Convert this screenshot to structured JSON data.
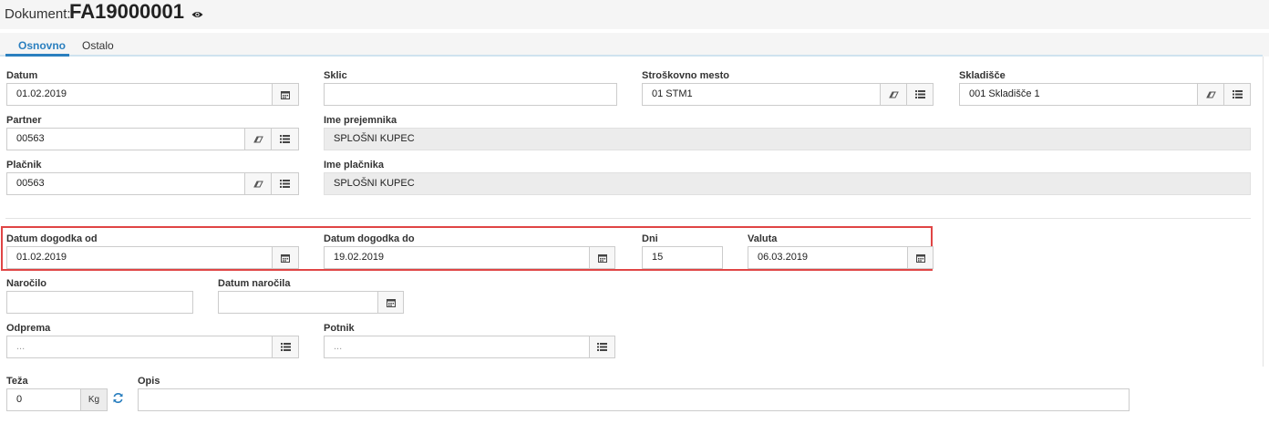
{
  "header": {
    "label": "Dokument:",
    "number": "FA19000001"
  },
  "tabs": [
    {
      "label": "Osnovno"
    },
    {
      "label": "Ostalo"
    }
  ],
  "form": {
    "datum": {
      "label": "Datum",
      "value": "01.02.2019"
    },
    "sklic": {
      "label": "Sklic",
      "value": ""
    },
    "strosek": {
      "label": "Stroškovno mesto",
      "value": "01 STM1"
    },
    "skladisce": {
      "label": "Skladišče",
      "value": "001 Skladišče 1"
    },
    "partner": {
      "label": "Partner",
      "value": "00563"
    },
    "ime_prejemnika": {
      "label": "Ime prejemnika",
      "value": "SPLOŠNI KUPEC"
    },
    "placnik": {
      "label": "Plačnik",
      "value": "00563"
    },
    "ime_placnika": {
      "label": "Ime plačnika",
      "value": "SPLOŠNI KUPEC"
    },
    "datum_od": {
      "label": "Datum dogodka od",
      "value": "01.02.2019"
    },
    "datum_do": {
      "label": "Datum dogodka do",
      "value": "19.02.2019"
    },
    "dni": {
      "label": "Dni",
      "value": "15"
    },
    "valuta": {
      "label": "Valuta",
      "value": "06.03.2019"
    },
    "narocilo": {
      "label": "Naročilo",
      "value": ""
    },
    "datum_narocila": {
      "label": "Datum naročila",
      "value": ""
    },
    "odprema": {
      "label": "Odprema",
      "placeholder": "..."
    },
    "potnik": {
      "label": "Potnik",
      "placeholder": "..."
    },
    "teza": {
      "label": "Teža",
      "value": "0",
      "unit": "Kg"
    },
    "opis": {
      "label": "Opis",
      "value": ""
    }
  },
  "colors": {
    "accent": "#2a7fbf",
    "highlight": "#e04545"
  }
}
